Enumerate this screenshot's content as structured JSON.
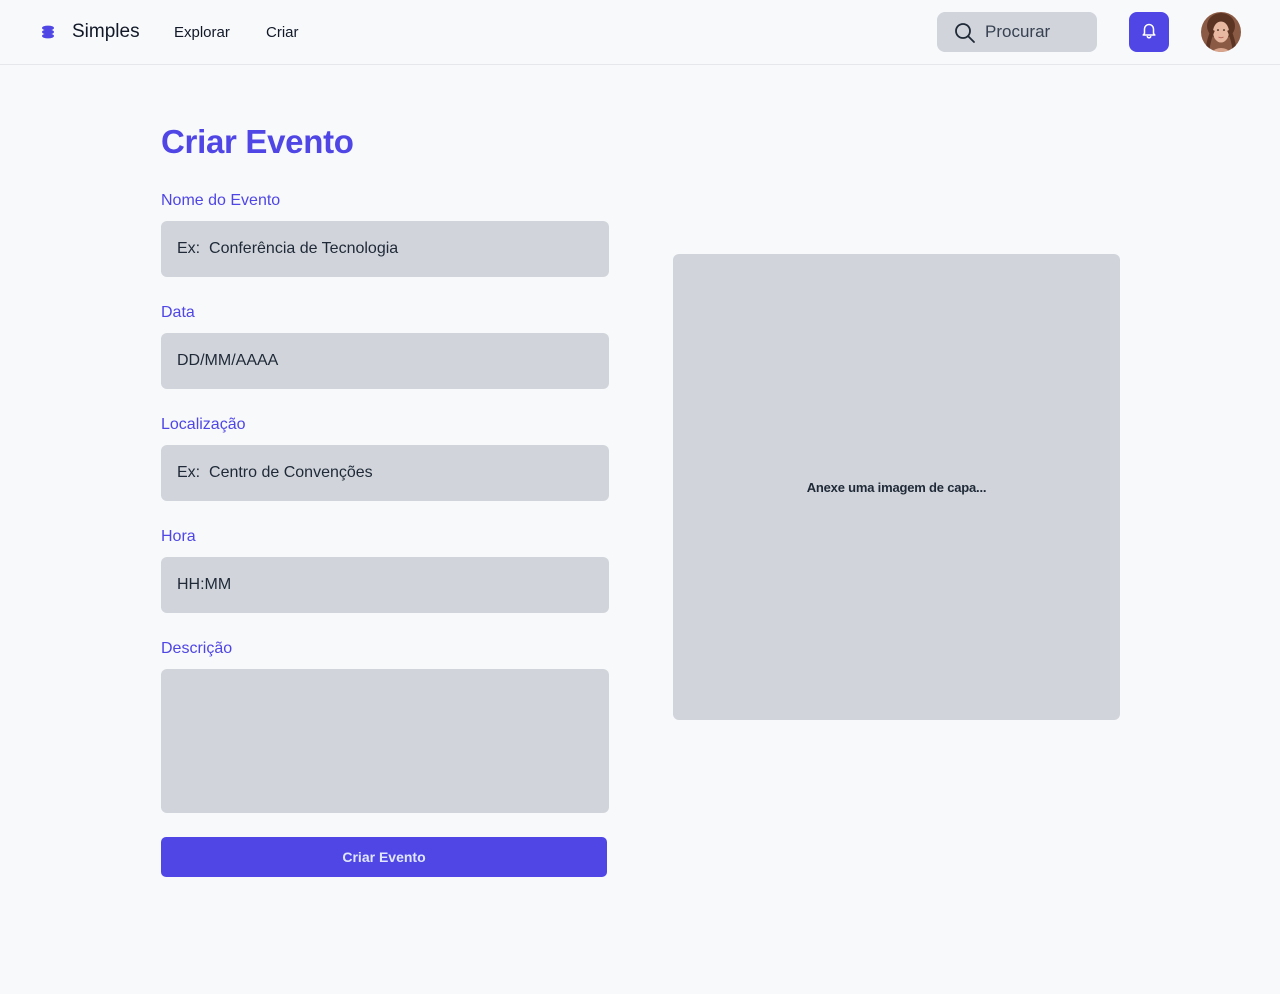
{
  "header": {
    "brand": "Simples",
    "nav": {
      "explore": "Explorar",
      "create": "Criar"
    },
    "search_placeholder": "Procurar"
  },
  "form": {
    "title": "Criar Evento",
    "name": {
      "label": "Nome do Evento",
      "placeholder": "Ex:  Conferência de Tecnologia"
    },
    "date": {
      "label": "Data",
      "placeholder": "DD/MM/AAAA"
    },
    "location": {
      "label": "Localização",
      "placeholder": "Ex:  Centro de Convenções"
    },
    "time": {
      "label": "Hora",
      "placeholder": "HH:MM"
    },
    "description": {
      "label": "Descrição",
      "placeholder": ""
    },
    "submit_label": "Criar Evento"
  },
  "cover": {
    "text": "Anexe uma imagem de capa..."
  },
  "colors": {
    "accent": "#4f46e5",
    "field_bg": "#d1d5db",
    "page_bg": "#f8f9fb"
  }
}
